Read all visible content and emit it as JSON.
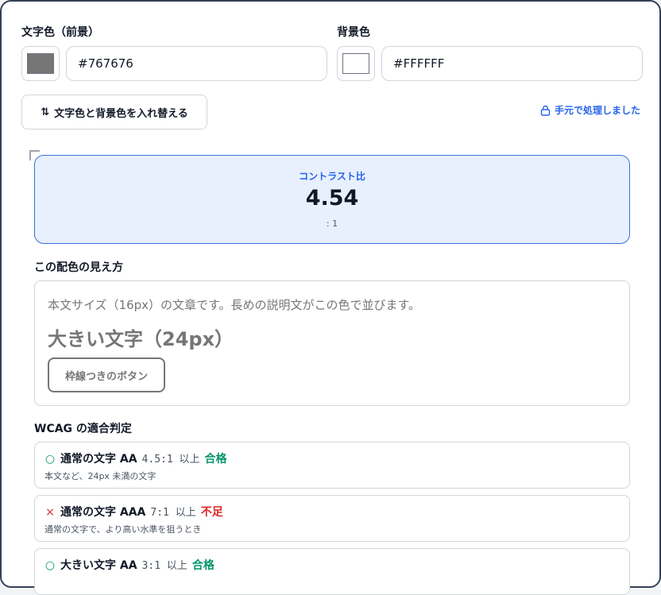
{
  "colors": {
    "foreground": "#767676",
    "background": "#FFFFFF",
    "accent": "#2563eb",
    "pass": "#059669",
    "fail": "#dc2626"
  },
  "foreground": {
    "label": "文字色（前景）",
    "value": "#767676"
  },
  "background": {
    "label": "背景色",
    "value": "#FFFFFF"
  },
  "swap": {
    "icon": "swap-vertical-icon",
    "label": "文字色と背景色を入れ替える"
  },
  "local_note": {
    "icon": "lock-icon",
    "label": "手元で処理しました"
  },
  "ratio": {
    "label": "コントラスト比",
    "value": "4.54",
    "unit": ": 1"
  },
  "preview": {
    "title": "この配色の見え方",
    "body_text": "本文サイズ（16px）の文章です。長めの説明文がこの色で並びます。",
    "large_text": "大きい文字（24px）",
    "button_label": "枠線つきのボタン"
  },
  "wcag": {
    "title": "WCAG の適合判定",
    "items": [
      {
        "mark": "○",
        "level": "通常の文字 AA",
        "threshold": "4.5:1 以上",
        "result": "合格",
        "status": "pass",
        "desc": "本文など、24px 未満の文字"
      },
      {
        "mark": "×",
        "level": "通常の文字 AAA",
        "threshold": "7:1 以上",
        "result": "不足",
        "status": "fail",
        "desc": "通常の文字で、より高い水準を狙うとき"
      },
      {
        "mark": "○",
        "level": "大きい文字 AA",
        "threshold": "3:1 以上",
        "result": "合格",
        "status": "pass",
        "desc": ""
      }
    ]
  }
}
